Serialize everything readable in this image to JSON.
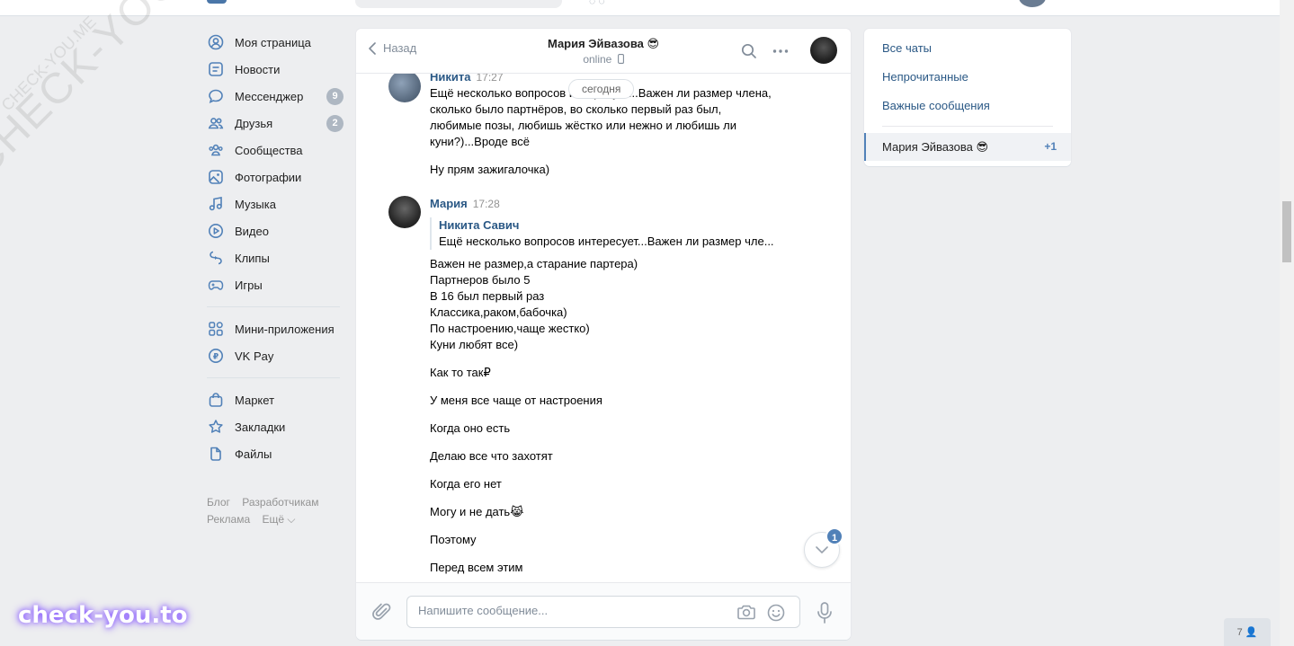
{
  "top": {
    "left_glyph": "◌ ◌"
  },
  "watermark": {
    "big": "CHECK-YOU.ME",
    "small": "CHECK-YOU.ME",
    "bottom": "check-you.to"
  },
  "leftnav": {
    "items": [
      {
        "label": "Моя страница",
        "icon": "user-circle-icon"
      },
      {
        "label": "Новости",
        "icon": "news-icon"
      },
      {
        "label": "Мессенджер",
        "icon": "message-icon",
        "count": "9"
      },
      {
        "label": "Друзья",
        "icon": "friends-icon",
        "count": "2"
      },
      {
        "label": "Сообщества",
        "icon": "communities-icon"
      },
      {
        "label": "Фотографии",
        "icon": "photo-icon"
      },
      {
        "label": "Музыка",
        "icon": "music-icon"
      },
      {
        "label": "Видео",
        "icon": "video-icon"
      },
      {
        "label": "Клипы",
        "icon": "clips-icon"
      },
      {
        "label": "Игры",
        "icon": "gamepad-icon"
      }
    ],
    "items2": [
      {
        "label": "Мини-приложения",
        "icon": "apps-icon"
      },
      {
        "label": "VK Pay",
        "icon": "vkpay-icon"
      }
    ],
    "items3": [
      {
        "label": "Маркет",
        "icon": "market-icon"
      },
      {
        "label": "Закладки",
        "icon": "bookmark-icon"
      },
      {
        "label": "Файлы",
        "icon": "file-icon"
      }
    ],
    "footer": {
      "blog": "Блог",
      "devs": "Разработчикам",
      "ads": "Реклама",
      "more": "Ещё ⌵"
    }
  },
  "chat": {
    "back_label": "Назад",
    "peer_name": "Мария Эйвазова 😎",
    "peer_status": "online",
    "day_badge": "сегодня",
    "messages": {
      "nikita": {
        "author": "Никита",
        "time": "17:27",
        "lines": [
          "Ещё несколько вопросов интересует...Важен ли размер члена,",
          "сколько было партнёров, во сколько первый раз был,",
          "любимые позы, любишь жёстко или нежно и любишь ли",
          "куни?)...Вроде всё"
        ],
        "extra": "Ну прям зажигалочка)"
      },
      "maria": {
        "author": "Мария",
        "time": "17:28",
        "fwd_author": "Никита Савич",
        "fwd_text": "Ещё несколько вопросов интересует...Важен ли размер чле...",
        "lines": [
          "Важен не размер,а старание партера)",
          "Партнеров было 5",
          "В 16 был первый раз",
          "Классика,раком,бабочка)",
          "По настроению,чаще жестко)",
          "Куни любят все)"
        ],
        "singles": [
          "Как то так₽",
          "У меня все чаще от настроения",
          "Когда оно есть",
          "Делаю все что захотят",
          "Когда его нет",
          "Могу и не дать😹",
          "Поэтому",
          "Перед всем этим"
        ]
      }
    },
    "unread_badge": "1",
    "composer": {
      "placeholder": "Напишите сообщение..."
    }
  },
  "right": {
    "all": "Все чаты",
    "unread": "Непрочитанные",
    "important": "Важные сообщения",
    "active_name": "Мария Эйвазова 😎",
    "active_plus": "+1"
  },
  "people": {
    "count": "7 👤"
  },
  "colors": {
    "accent": "#5181b8",
    "link": "#2a5885",
    "bg": "#edeef0"
  }
}
